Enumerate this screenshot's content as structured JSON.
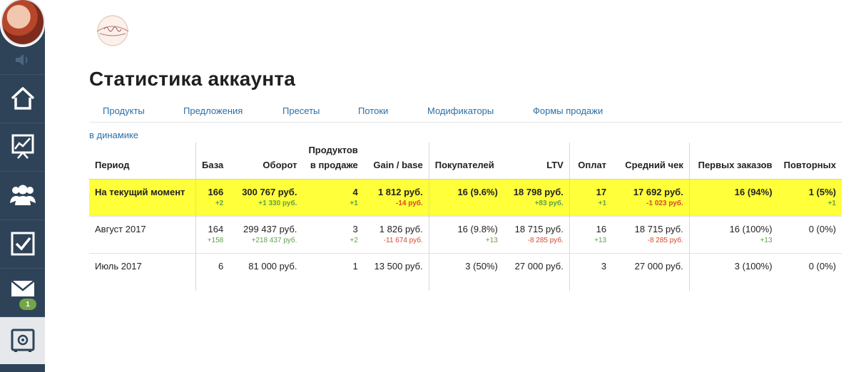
{
  "sidebar": {
    "mail_badge": "1",
    "icons": [
      "speaker-icon",
      "home-icon",
      "chart-icon",
      "users-icon",
      "checkbox-icon",
      "mail-icon",
      "safe-icon"
    ]
  },
  "page": {
    "title": "Статистика аккаунта",
    "dynamics_link": "в динамике"
  },
  "tabs": [
    "Продукты",
    "Предложения",
    "Пресеты",
    "Потоки",
    "Модификаторы",
    "Формы продажи"
  ],
  "table": {
    "headers": {
      "period": "Период",
      "base": "База",
      "turnover": "Оборот",
      "products_line1": "Продуктов",
      "products_line2": "в продаже",
      "gain": "Gain / base",
      "buyers": "Покупателей",
      "ltv": "LTV",
      "payments": "Оплат",
      "avg_check": "Средний чек",
      "first_orders": "Первых заказов",
      "repeat": "Повторных"
    },
    "rows": [
      {
        "period": "На текущий момент",
        "base": "166",
        "base_d": "+2",
        "turnover": "300 767 руб.",
        "turnover_d": "+1 330 руб.",
        "products": "4",
        "products_d": "+1",
        "gain": "1 812 руб.",
        "gain_d": "-14 руб.",
        "buyers": "16 (9.6%)",
        "buyers_d": "",
        "ltv": "18 798 руб.",
        "ltv_d": "+83 руб.",
        "payments": "17",
        "payments_d": "+1",
        "avg_check": "17 692 руб.",
        "avg_check_d": "-1 023 руб.",
        "first_orders": "16 (94%)",
        "first_orders_d": "",
        "repeat": "1 (5%)",
        "repeat_d": "+1"
      },
      {
        "period": "Август 2017",
        "base": "164",
        "base_d": "+158",
        "turnover": "299 437 руб.",
        "turnover_d": "+218 437 руб.",
        "products": "3",
        "products_d": "+2",
        "gain": "1 826 руб.",
        "gain_d": "-11 674 руб.",
        "buyers": "16 (9.8%)",
        "buyers_d": "+13",
        "ltv": "18 715 руб.",
        "ltv_d": "-8 285 руб.",
        "payments": "16",
        "payments_d": "+13",
        "avg_check": "18 715 руб.",
        "avg_check_d": "-8 285 руб.",
        "first_orders": "16 (100%)",
        "first_orders_d": "+13",
        "repeat": "0 (0%)",
        "repeat_d": ""
      },
      {
        "period": "Июль 2017",
        "base": "6",
        "base_d": "",
        "turnover": "81 000 руб.",
        "turnover_d": "",
        "products": "1",
        "products_d": "",
        "gain": "13 500 руб.",
        "gain_d": "",
        "buyers": "3 (50%)",
        "buyers_d": "",
        "ltv": "27 000 руб.",
        "ltv_d": "",
        "payments": "3",
        "payments_d": "",
        "avg_check": "27 000 руб.",
        "avg_check_d": "",
        "first_orders": "3 (100%)",
        "first_orders_d": "",
        "repeat": "0 (0%)",
        "repeat_d": ""
      }
    ]
  },
  "colors": {
    "sidebar": "#2f4358",
    "link": "#2c6fa7",
    "highlight": "#ffff3a",
    "positive": "#5ea247",
    "negative": "#d9472b",
    "badge": "#73a646"
  }
}
